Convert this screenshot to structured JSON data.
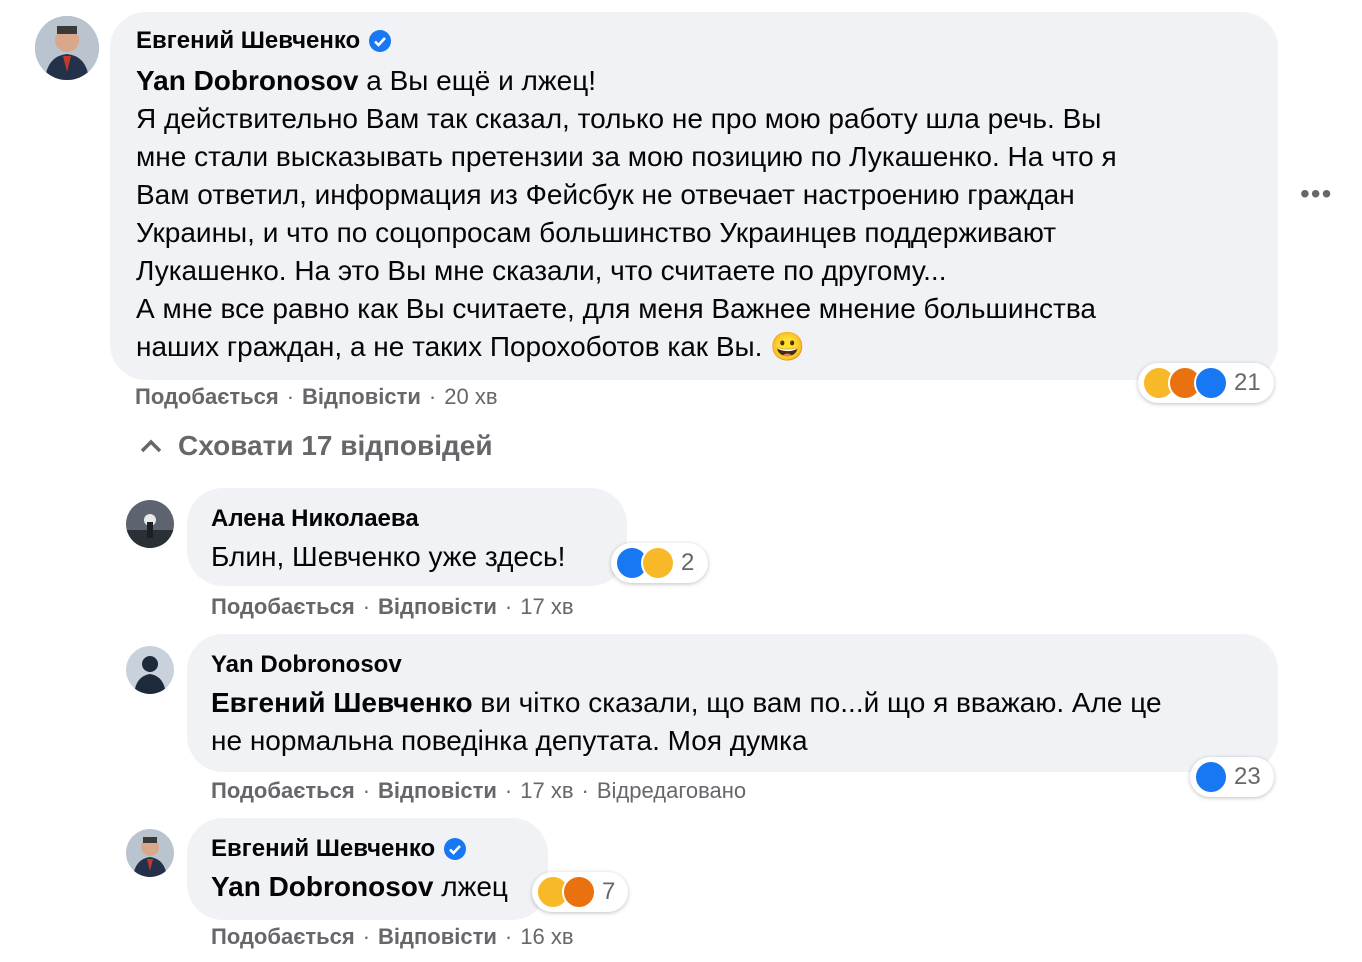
{
  "comments": {
    "c1": {
      "author": "Евгений Шевченко",
      "mention": "Yan Dobronosov",
      "lines": [
        " а Вы ещё и лжец!",
        "Я действительно Вам так сказал, только не про мою работу шла речь. Вы",
        "мне стали высказывать претензии за мою позицию по Лукашенко. На что я",
        "Вам ответил, информация из Фейсбук не отвечает настроению граждан",
        "Украины, и что по соцопросам большинство Украинцев поддерживают",
        "Лукашенко. На это Вы мне сказали, что считаете по другому...",
        "А мне все равно как Вы считаете, для меня Важнее мнение большинства",
        "наших граждан, а не таких Порохоботов как Вы. 😀"
      ],
      "like": "Подобається",
      "reply": "Відповісти",
      "time": "20 хв",
      "reaction_count": "21"
    },
    "toggle_label": "Сховати 17 відповідей",
    "c2": {
      "author": "Алена Николаева",
      "text": "Блин, Шевченко уже здесь!",
      "like": "Подобається",
      "reply": "Відповісти",
      "time": "17 хв",
      "reaction_count": "2"
    },
    "c3": {
      "author": "Yan Dobronosov",
      "mention": "Евгений Шевченко",
      "line1": " ви чітко сказали, що вам по...й що я вважаю. Але це",
      "line2": "не нормальна поведінка депутата. Моя думка",
      "like": "Подобається",
      "reply": "Відповісти",
      "time": "17 хв",
      "edited": "Відредаговано",
      "reaction_count": "23"
    },
    "c4": {
      "author": "Евгений Шевченко",
      "mention": "Yan Dobronosov",
      "text": " лжец",
      "like": "Подобається",
      "reply": "Відповісти",
      "time": "16 хв",
      "reaction_count": "7"
    }
  },
  "colors": {
    "bubble": "#f0f2f5",
    "meta": "#65676b",
    "like": "#1877f2",
    "haha": "#f7b928",
    "angry": "#e9710f"
  }
}
